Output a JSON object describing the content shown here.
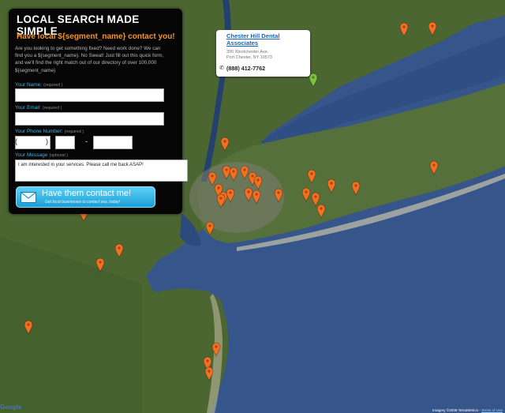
{
  "form": {
    "title": "LOCAL SEARCH MADE SIMPLE",
    "subtitle": "Have local ${segment_name} contact you!",
    "description_lines": [
      "Are you looking to get something fixed? Need work done? We can",
      "find you a ${segment_name}. No Sweat! Just fill out this quick form,",
      "and we'll find the right match out of our directory of over 100,000",
      "${segment_name}"
    ],
    "name_label": "Your Name:",
    "name_hint": "(required )",
    "email_label": "Your Email:",
    "email_hint": "(required )",
    "phone_label": "Your Phone Number:",
    "phone_hint": "(required )",
    "phone_open": "(",
    "phone_close": ")",
    "phone_dash": "-",
    "message_label": "Your Message",
    "message_hint": "(optional )",
    "message_value": "I am interested in your services. Please call me back ASAP!",
    "button_label": "Have them contact me!",
    "button_sub": "Get local businesses to contact you, today!"
  },
  "info_window": {
    "business_name": "Chester Hill Dental Associates",
    "address_line1": "395 Westchester Ave.",
    "address_line2": "Port Chester, NY 10573",
    "phone": "(888) 412-7762"
  },
  "map": {
    "attribution": "Imagery ©2009 TerraMetrics -",
    "terms_link": "Terms of Use",
    "logo": "Google",
    "marker_color": "#f36f21",
    "selected_marker_color": "#7dc243",
    "water_color": "#36558a",
    "land_color": "#4f6a34"
  }
}
